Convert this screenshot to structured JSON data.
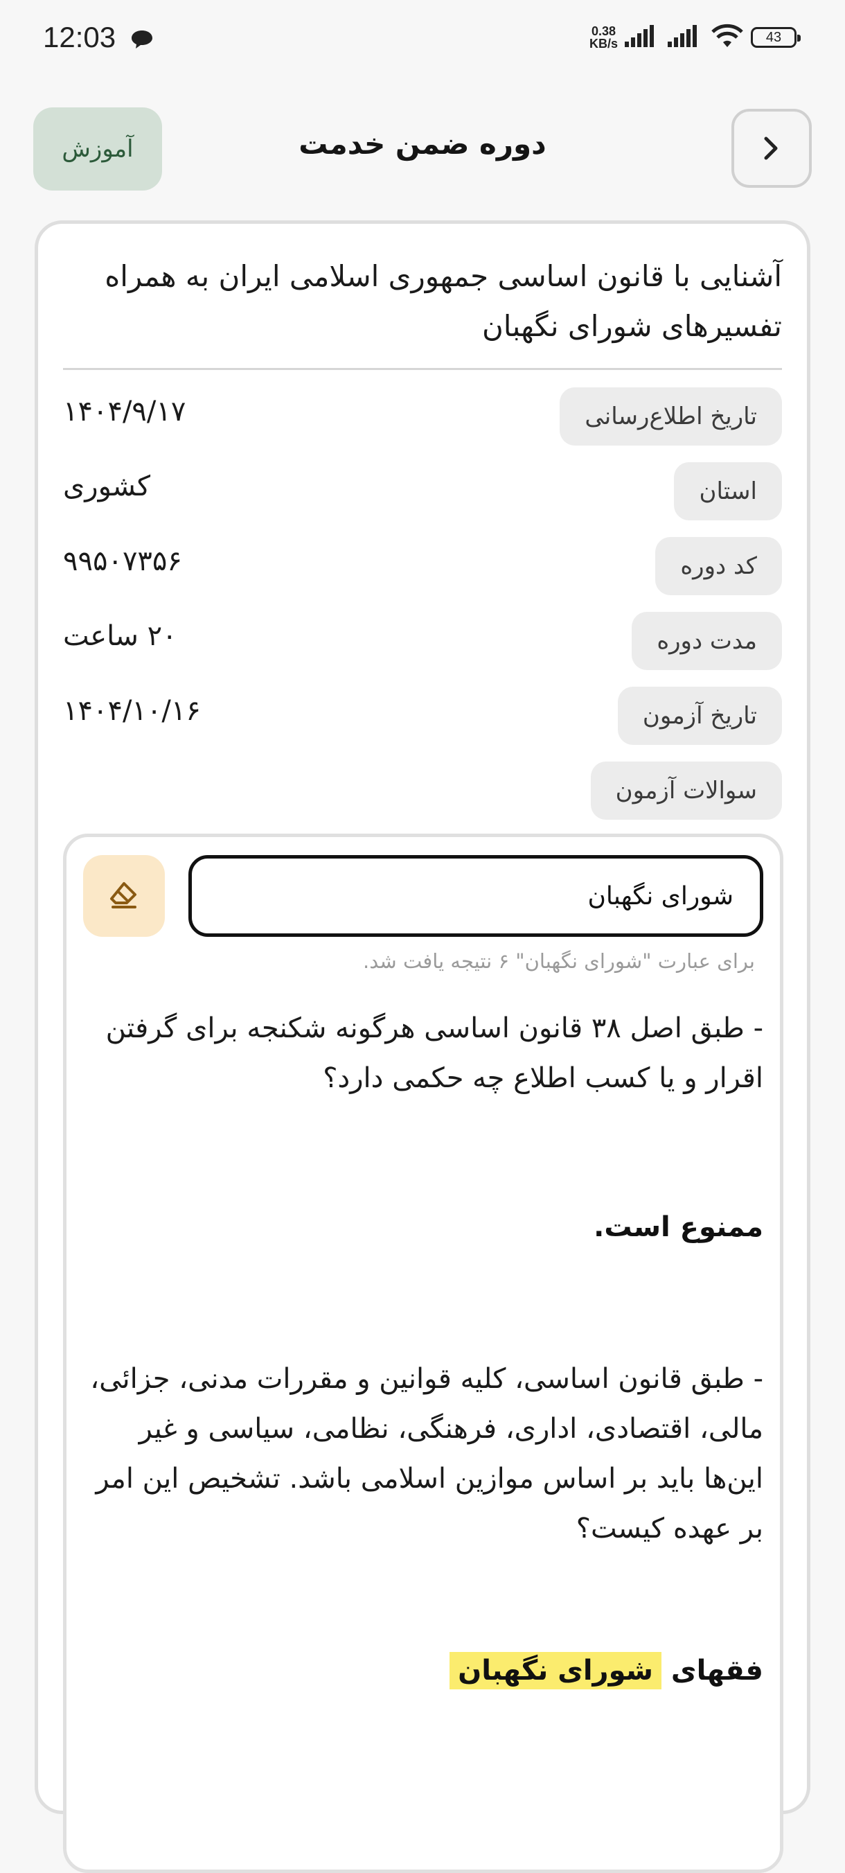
{
  "status_bar": {
    "time": "12:03",
    "net_speed_value": "0.38",
    "net_speed_unit": "KB/s",
    "battery": "43"
  },
  "header": {
    "title": "دوره ضمن خدمت",
    "edu_button": "آموزش"
  },
  "course": {
    "title": "آشنایی با قانون اساسی جمهوری اسلامی ایران به همراه تفسیرهای شورای نگهبان",
    "details": [
      {
        "label": "تاریخ اطلاع‌رسانی",
        "value": "۱۴۰۴/۹/۱۷"
      },
      {
        "label": "استان",
        "value": "کشوری"
      },
      {
        "label": "کد دوره",
        "value": "۹۹۵۰۷۳۵۶"
      },
      {
        "label": "مدت دوره",
        "value": "۲۰ ساعت"
      },
      {
        "label": "تاریخ آزمون",
        "value": "۱۴۰۴/۱۰/۱۶"
      },
      {
        "label": "سوالات آزمون",
        "value": ""
      }
    ]
  },
  "search": {
    "query": "شورای نگهبان",
    "result_info": "برای عبارت \"شورای نگهبان\" ۶ نتیجه یافت شد."
  },
  "results": [
    {
      "question": "- طبق اصل ۳۸ قانون اساسی هرگونه شکنجه برای گرفتن اقرار و یا کسب اطلاع چه حکمی دارد؟",
      "answer": "ممنوع است."
    },
    {
      "question": "- طبق قانون اساسی، کلیه قوانین و مقررات مدنی، جزائی، مالی، اقتصادی، اداری، فرهنگی، نظامی، سیاسی و غیر این‌ها باید بر اساس موازین اسلامی باشد. تشخیص این امر بر عهده کیست؟",
      "answer_prefix": "فقهای",
      "answer_highlight": "شورای نگهبان"
    }
  ],
  "colors": {
    "edu_button_bg": "#d3e0d6",
    "clear_button_bg": "#fbe8c8",
    "highlight": "#fbec6e"
  }
}
